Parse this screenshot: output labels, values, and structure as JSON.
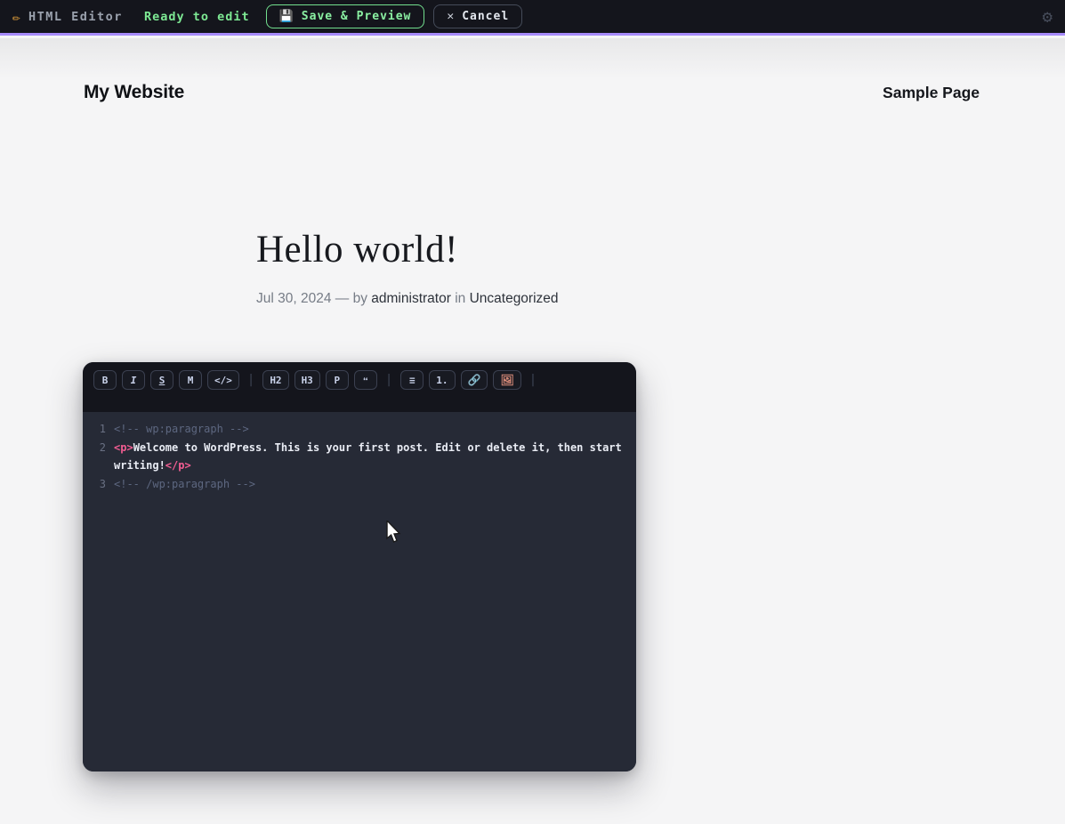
{
  "topbar": {
    "pencil_icon": "✏",
    "title": "HTML Editor",
    "status": "Ready to edit",
    "save": {
      "icon": "💾",
      "label": "Save & Preview"
    },
    "cancel": {
      "icon": "✕",
      "label": "Cancel"
    },
    "gear_icon": "⚙",
    "colors": {
      "accent_purple": "#a78bfa",
      "accent_green": "#7de893",
      "bar_background": "#14151c"
    }
  },
  "site": {
    "name": "My Website",
    "nav_link": "Sample Page"
  },
  "post": {
    "title": "Hello world!",
    "meta": {
      "date": "Jul 30, 2024",
      "separator": "—",
      "by_label": "by",
      "author": "administrator",
      "in_label": "in",
      "category": "Uncategorized"
    }
  },
  "editor": {
    "toolbar": {
      "separator": "|",
      "buttons": [
        {
          "label": "B"
        },
        {
          "label": "I"
        },
        {
          "label": "S"
        },
        {
          "label": "M"
        },
        {
          "label": "</>"
        },
        {
          "label": "H2"
        },
        {
          "label": "H3"
        },
        {
          "label": "P"
        },
        {
          "label": "❝"
        },
        {
          "label": "≡"
        },
        {
          "label": "1."
        },
        {
          "label": "🔗"
        },
        {
          "label": "🖼"
        }
      ]
    },
    "code": {
      "colors": {
        "comment": "#5d6780",
        "tag": "#f25d92",
        "plain": "#e9ecf4",
        "background": "#262a36"
      },
      "lines": [
        {
          "num": "1",
          "tokens": [
            {
              "text": "<!-- wp:paragraph -->",
              "type": "comment"
            }
          ]
        },
        {
          "num": "2",
          "tokens": [
            {
              "text": "<p>",
              "type": "tag"
            },
            {
              "text": "Welcome to WordPress. This is your first post. Edit or delete it, then start writing!",
              "type": "plain"
            },
            {
              "text": "</p>",
              "type": "tag"
            }
          ]
        },
        {
          "num": "3",
          "tokens": [
            {
              "text": "<!-- /wp:paragraph -->",
              "type": "comment"
            }
          ]
        }
      ]
    }
  }
}
